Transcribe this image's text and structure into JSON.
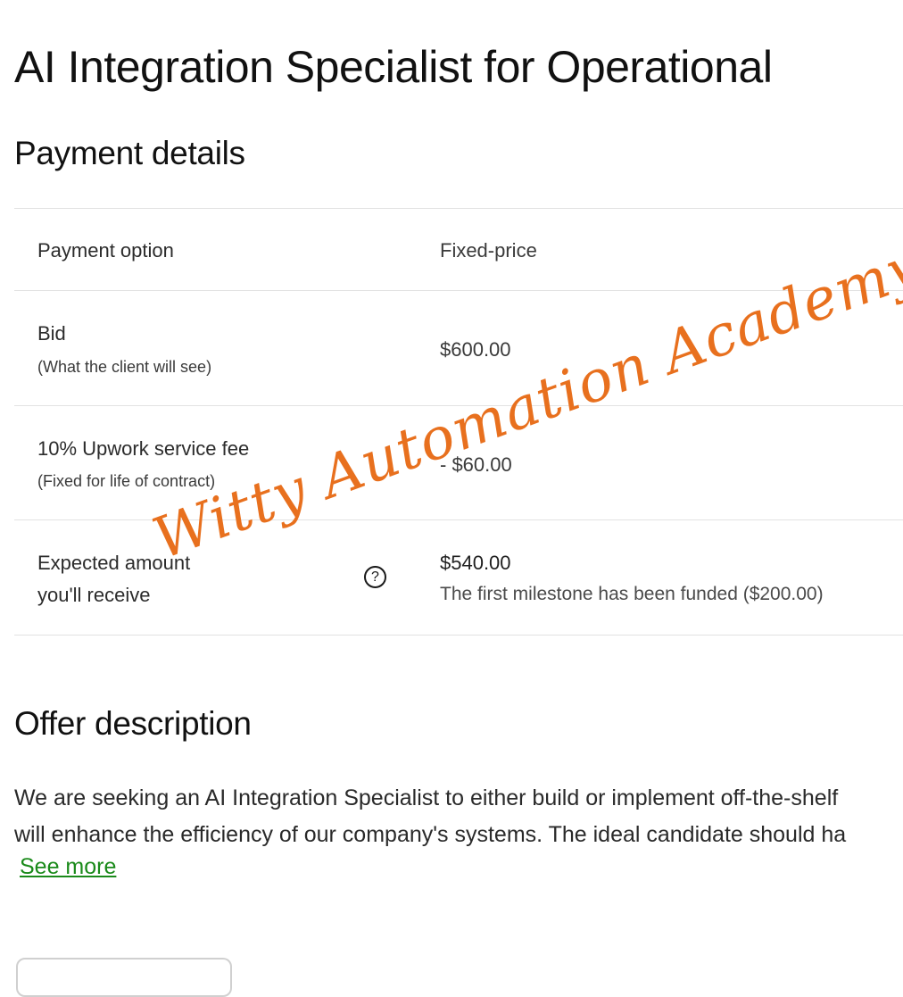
{
  "header": {
    "job_title": "AI Integration Specialist for Operational"
  },
  "payment": {
    "section_title": "Payment details",
    "rows": [
      {
        "label": "Payment option",
        "value": "Fixed-price"
      },
      {
        "label": "Bid",
        "sublabel": "(What the client will see)",
        "value": "$600.00"
      },
      {
        "label": "10% Upwork service fee",
        "sublabel": "(Fixed for life of contract)",
        "value": "- $60.00"
      },
      {
        "label_line1": "Expected amount",
        "label_line2": "you'll receive",
        "help_icon": "?",
        "value": "$540.00",
        "note": "The first milestone has been funded ($200.00)"
      }
    ]
  },
  "offer": {
    "section_title": "Offer description",
    "description_line1": "We are seeking an AI Integration Specialist to either build or implement off-the-shelf",
    "description_line2": "will enhance the efficiency of our company's systems. The ideal candidate should ha",
    "see_more": "See more"
  },
  "watermark": {
    "text": "Witty Automation Academy",
    "color": "#e8701e"
  },
  "colors": {
    "link": "#1a8a1a",
    "divider": "#e2e2e2"
  }
}
